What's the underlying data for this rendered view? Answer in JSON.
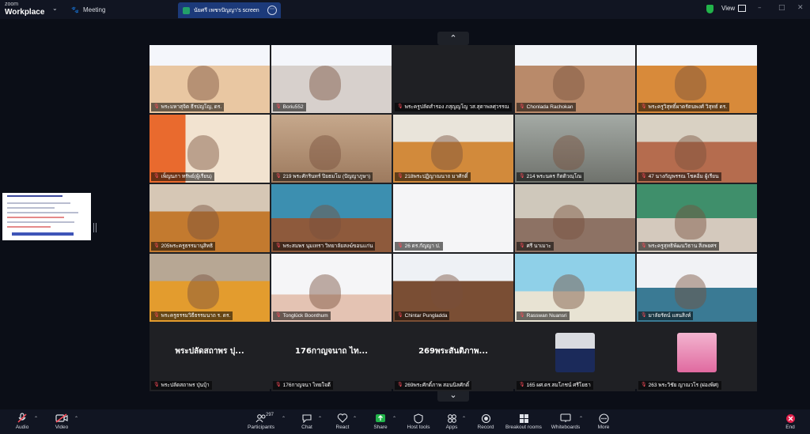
{
  "app": {
    "brand_line1": "zoom",
    "brand_line2": "Workplace",
    "meeting_tab": "Meeting",
    "screen_tab": "นัยศรี เพชรปัญญา's screen",
    "view_label": "View"
  },
  "tiles": [
    {
      "name": "พระมหาสุจิต ธีรปญโญ, ดร.",
      "muted": true
    },
    {
      "name": "Boriu552",
      "muted": true
    },
    {
      "name": "พระครูปลัดสำรอง ภสุญญโญ วส.สุตาพลศุวรรณ",
      "muted": true
    },
    {
      "name": "Chonlada Rachokan",
      "muted": true
    },
    {
      "name": "พระครูวิสุทธิ์ผาดรัตนพงศ์ วิสุทธ์ ดร.",
      "muted": true
    },
    {
      "name": "เพ็ญนภา ทรัพย์(ผู้เรียน)",
      "muted": true
    },
    {
      "name": "219 พระศักรินทร์ ปิยธมโม (ปัญญาภูษา)",
      "muted": true
    },
    {
      "name": "218พระปฏิญาณนาถ มาศักดิ์",
      "muted": true
    },
    {
      "name": "214 พระนคร กิตติวณฺโณ",
      "muted": true
    },
    {
      "name": "47 นางกัญพรรณ โชคอิ่ม ผู้เรียน",
      "muted": true
    },
    {
      "name": "205พระครูธรรมานุสิทธิ",
      "muted": true
    },
    {
      "name": "พระสมพร นุมเทรา วิทยาลัยสงฆ์ขอนแก่น",
      "muted": true
    },
    {
      "name": "26 ดร.กัญญา ป.",
      "muted": true
    },
    {
      "name": "ศรี นาเมาะ",
      "muted": true
    },
    {
      "name": "พระครูสุทธิพัฒนวิธาน สิ่งพยศร",
      "muted": true
    },
    {
      "name": "พระครูธรรมวิธีธรรมนาถ ร. ดร.",
      "muted": true
    },
    {
      "name": "Tonglück Boonthum",
      "muted": true
    },
    {
      "name": "Chintar Pungladda",
      "muted": true
    },
    {
      "name": "Rasswan Nuansri",
      "muted": true
    },
    {
      "name": "มาลัยรัตน์ แสนสิงห์",
      "muted": true
    },
    {
      "name": "พระปลัดสถาพร ปุ่นบุ้า",
      "muted": true,
      "big": "พระปลัดสถาพร ปุ..."
    },
    {
      "name": "176กาญจนา ไทยใจดี",
      "muted": true,
      "big": "176กาญจนาถ ไท..."
    },
    {
      "name": "269พระศักดิ์ภาพ สอนนิลศักดิ์",
      "muted": true,
      "big": "269พระสันติภาพ..."
    },
    {
      "name": "165 ผศ.ดร.สมโภชน์ ศรีโยธา",
      "muted": true
    },
    {
      "name": "263 พระวิชัย ญาณวโร (ผ่องพิศ)",
      "muted": true
    }
  ],
  "toolbar": {
    "audio": "Audio",
    "video": "Video",
    "participants": "Participants",
    "participants_count": "297",
    "chat": "Chat",
    "react": "React",
    "share": "Share",
    "host_tools": "Host tools",
    "apps": "Apps",
    "record": "Record",
    "breakout": "Breakout rooms",
    "whiteboards": "Whiteboards",
    "more": "More",
    "end": "End"
  },
  "colors": {
    "accent": "#1c3a7a",
    "share_green": "#22b34a",
    "mute_red": "#ff4d5a",
    "end_red": "#e0204b"
  }
}
